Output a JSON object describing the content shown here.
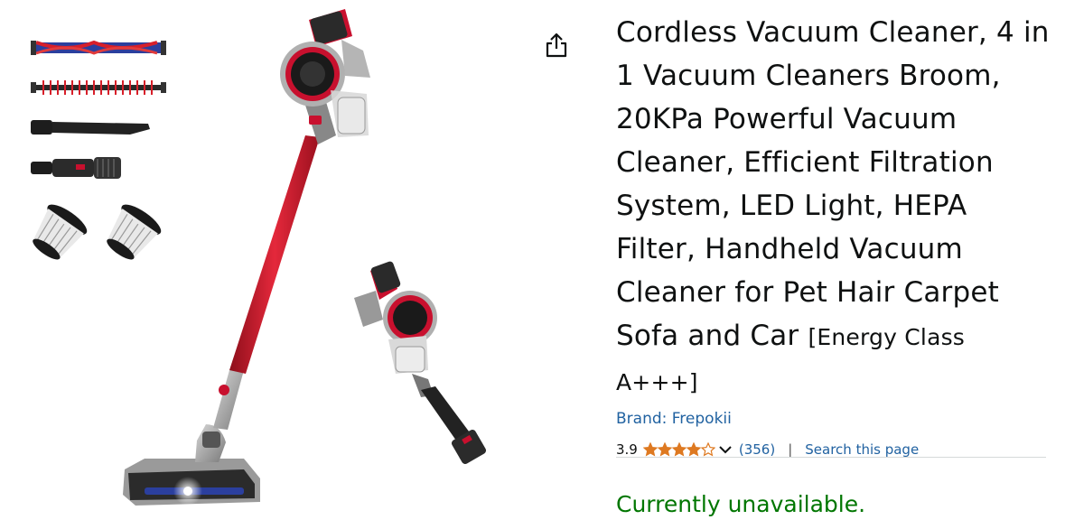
{
  "product": {
    "title": "Cordless Vacuum Cleaner, 4 in 1 Vacuum Cleaners Broom, 20KPa Powerful Vacuum Cleaner, Efficient Filtration System, LED Light, HEPA Filter, Handheld Vacuum Cleaner for Pet Hair Carpet Sofa and Car",
    "energy_class": "[Energy Class A+++]",
    "brand_label": "Brand: Frepokii",
    "rating_value": "3.9",
    "rating_fraction": 0.78,
    "rating_count": "(356)",
    "separator": "|",
    "search_link": "Search this page",
    "availability": "Currently unavailable."
  },
  "icons": {
    "share": "share-icon",
    "star": "star-icon",
    "chevron": "chevron-down-icon"
  },
  "colors": {
    "link": "#2162a1",
    "star": "#de7921",
    "available": "#007600",
    "accent_red": "#c8102e"
  }
}
